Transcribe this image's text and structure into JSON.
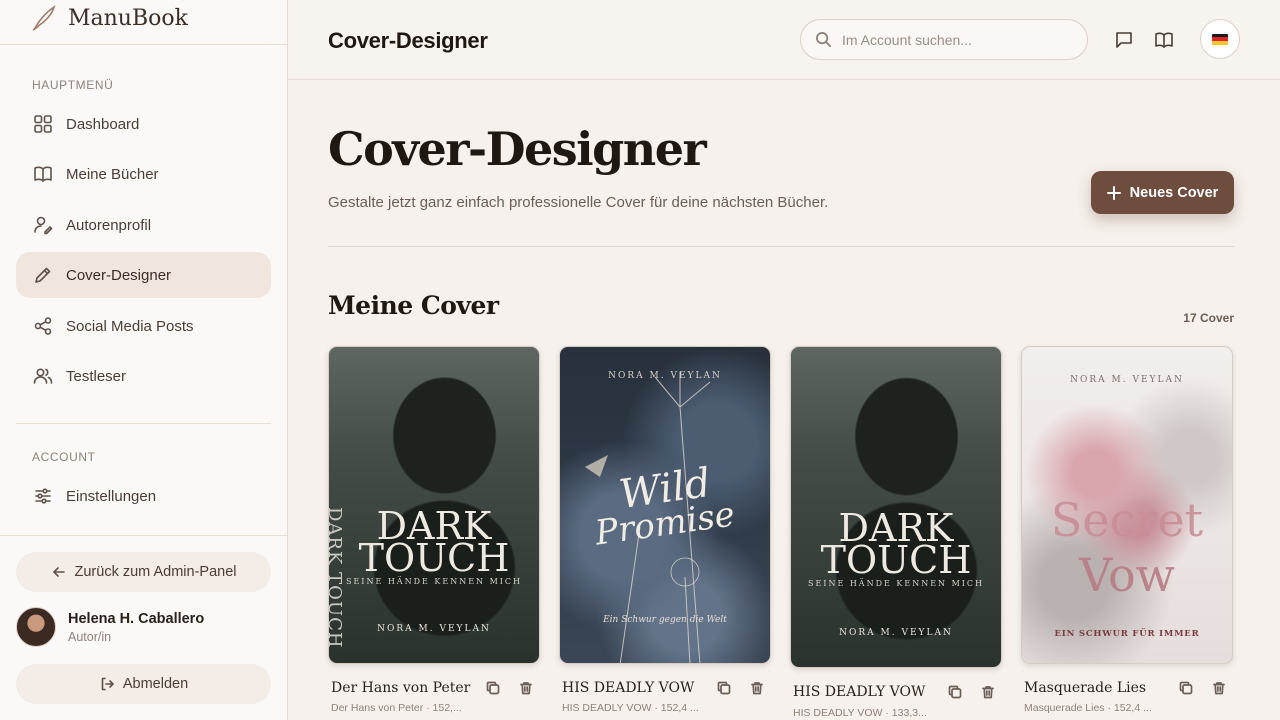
{
  "brand": {
    "name": "ManuBook"
  },
  "sidebar": {
    "main_label": "HAUPTMENÜ",
    "items": [
      {
        "label": "Dashboard",
        "icon": "dashboard-icon"
      },
      {
        "label": "Meine Bücher",
        "icon": "book-icon"
      },
      {
        "label": "Autorenprofil",
        "icon": "user-edit-icon"
      },
      {
        "label": "Cover-Designer",
        "icon": "pencil-icon",
        "active": true
      },
      {
        "label": "Social Media Posts",
        "icon": "share-icon"
      },
      {
        "label": "Testleser",
        "icon": "users-icon"
      }
    ],
    "account_label": "ACCOUNT",
    "account_items": [
      {
        "label": "Einstellungen",
        "icon": "sliders-icon"
      }
    ],
    "back_button": "Zurück zum Admin-Panel",
    "user": {
      "name": "Helena H. Caballero",
      "role": "Autor/in"
    },
    "logout_button": "Abmelden"
  },
  "header": {
    "title": "Cover-Designer",
    "search_placeholder": "Im Account suchen...",
    "language": "de"
  },
  "main": {
    "title": "Cover-Designer",
    "subtitle": "Gestalte jetzt ganz einfach professionelle Cover für deine nächsten Bücher.",
    "new_button": "Neues Cover",
    "section_title": "Meine Cover",
    "count": "17 Cover",
    "covers": [
      {
        "name": "Der Hans von Peter",
        "meta": "Der Hans von Peter · 152,...",
        "cover_title_1": "DARK",
        "cover_title_2": "TOUCH",
        "cover_sub": "SEINE HÄNDE KENNEN MICH",
        "cover_author": "NORA M. VEYLAN",
        "spine": "DARK TOUCH"
      },
      {
        "name": "HIS DEADLY VOW",
        "meta": "HIS DEADLY VOW · 152,4 ...",
        "cover_title_1": "Wild",
        "cover_title_2": "Promise",
        "cover_sub": "Ein Schwur gegen die Welt",
        "cover_author": "NORA M. VEYLAN"
      },
      {
        "name": "HIS DEADLY VOW",
        "meta": "HIS DEADLY VOW · 133,3...",
        "cover_title_1": "DARK",
        "cover_title_2": "TOUCH",
        "cover_sub": "SEINE HÄNDE KENNEN MICH",
        "cover_author": "NORA M. VEYLAN"
      },
      {
        "name": "Masquerade Lies",
        "meta": "Masquerade Lies · 152,4 ...",
        "cover_title_1": "Secret",
        "cover_title_2": "Vow",
        "cover_sub": "EIN SCHWUR FÜR IMMER",
        "cover_author": "NORA M. VEYLAN"
      }
    ]
  },
  "colors": {
    "accent": "#6e4c3e",
    "active_nav": "#f1e5df",
    "background": "#f6f1ec"
  }
}
